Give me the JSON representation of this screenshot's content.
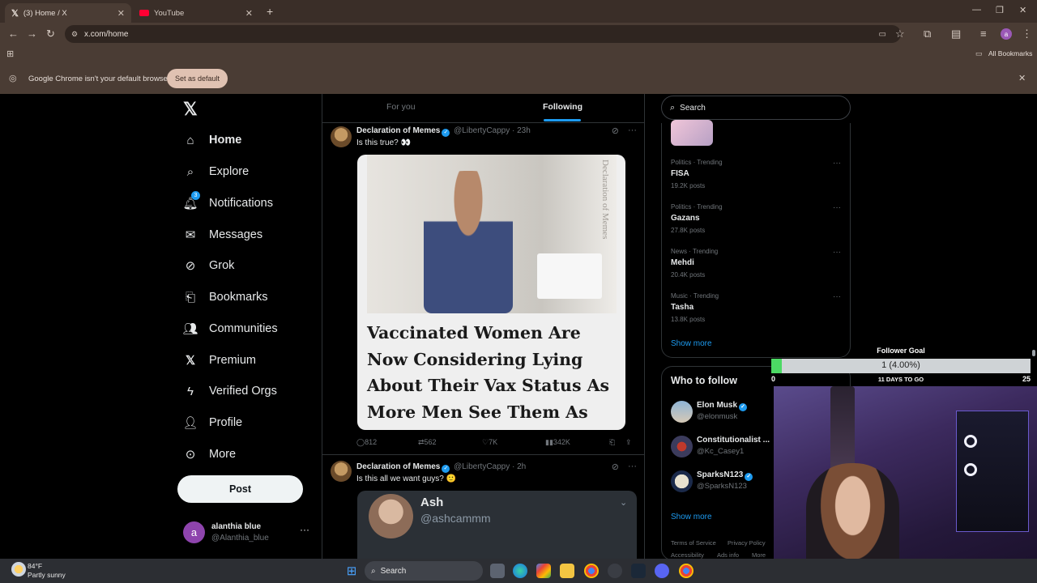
{
  "browser": {
    "tabs": [
      {
        "title": "(3) Home / X",
        "icon": "x-logo-icon",
        "active": true
      },
      {
        "title": "YouTube",
        "icon": "youtube-icon",
        "active": false
      }
    ],
    "url": "x.com/home",
    "bookmarks_label": "All Bookmarks",
    "infobar_text": "Google Chrome isn't your default browser",
    "set_default_label": "Set as default",
    "profile_initial": "a"
  },
  "sidebar": {
    "items": [
      {
        "label": "Home",
        "icon": "home-icon"
      },
      {
        "label": "Explore",
        "icon": "search-icon"
      },
      {
        "label": "Notifications",
        "icon": "bell-icon",
        "badge": "3"
      },
      {
        "label": "Messages",
        "icon": "mail-icon"
      },
      {
        "label": "Grok",
        "icon": "grok-icon"
      },
      {
        "label": "Bookmarks",
        "icon": "bookmark-icon"
      },
      {
        "label": "Communities",
        "icon": "people-icon"
      },
      {
        "label": "Premium",
        "icon": "x-logo-icon"
      },
      {
        "label": "Verified Orgs",
        "icon": "lightning-icon"
      },
      {
        "label": "Profile",
        "icon": "person-icon"
      },
      {
        "label": "More",
        "icon": "more-circle-icon"
      }
    ],
    "post_label": "Post",
    "account": {
      "initial": "a",
      "name": "alanthia blue",
      "handle": "@Alanthia_blue"
    }
  },
  "timeline": {
    "tabs": [
      "For you",
      "Following"
    ],
    "active_tab": "Following",
    "tweets": [
      {
        "name": "Declaration of Memes",
        "handle": "@LibertyCappy",
        "time": "· 23h",
        "text": "Is this true? 👀",
        "card_watermark": "Declaration of Memes",
        "card_headline": "Vaccinated Women Are Now Considering Lying About Their Vax Status As More Men See Them As Infertility Risk",
        "replies": "812",
        "reposts": "562",
        "likes": "7K",
        "views": "342K"
      },
      {
        "name": "Declaration of Memes",
        "handle": "@LibertyCappy",
        "time": "· 2h",
        "text": "Is this all we want guys? 🙂",
        "embed_name": "Ash",
        "embed_handle": "@ashcammm"
      }
    ]
  },
  "right": {
    "search_placeholder": "Search",
    "trends": [
      {
        "meta": "Politics · Trending",
        "title": "FISA",
        "count": "19.2K posts"
      },
      {
        "meta": "Politics · Trending",
        "title": "Gazans",
        "count": "27.8K posts"
      },
      {
        "meta": "News · Trending",
        "title": "Mehdi",
        "count": "20.4K posts"
      },
      {
        "meta": "Music · Trending",
        "title": "Tasha",
        "count": "13.8K posts"
      }
    ],
    "show_more": "Show more",
    "who_to_follow_title": "Who to follow",
    "follow": [
      {
        "name": "Elon Musk",
        "handle": "@elonmusk"
      },
      {
        "name": "Constitutionalist ...",
        "handle": "@Kc_Casey1"
      },
      {
        "name": "SparksN123",
        "handle": "@SparksN123"
      }
    ],
    "footer": [
      "Terms of Service",
      "Privacy Policy",
      "Accessibility",
      "Ads info",
      "More"
    ]
  },
  "overlay": {
    "goal_title": "Follower Goal",
    "goal_text": "1 (4.00%)",
    "goal_progress": 0.04,
    "goal_min": "0",
    "goal_max": "25",
    "days_to_go": "11 DAYS TO GO"
  },
  "taskbar": {
    "weather_temp": "84°F",
    "weather_desc": "Partly sunny",
    "search_label": "Search"
  },
  "colors": {
    "accent": "#1d9bf0",
    "chrome_bg": "#4a3c34",
    "goal_fill": "#4cd964"
  }
}
